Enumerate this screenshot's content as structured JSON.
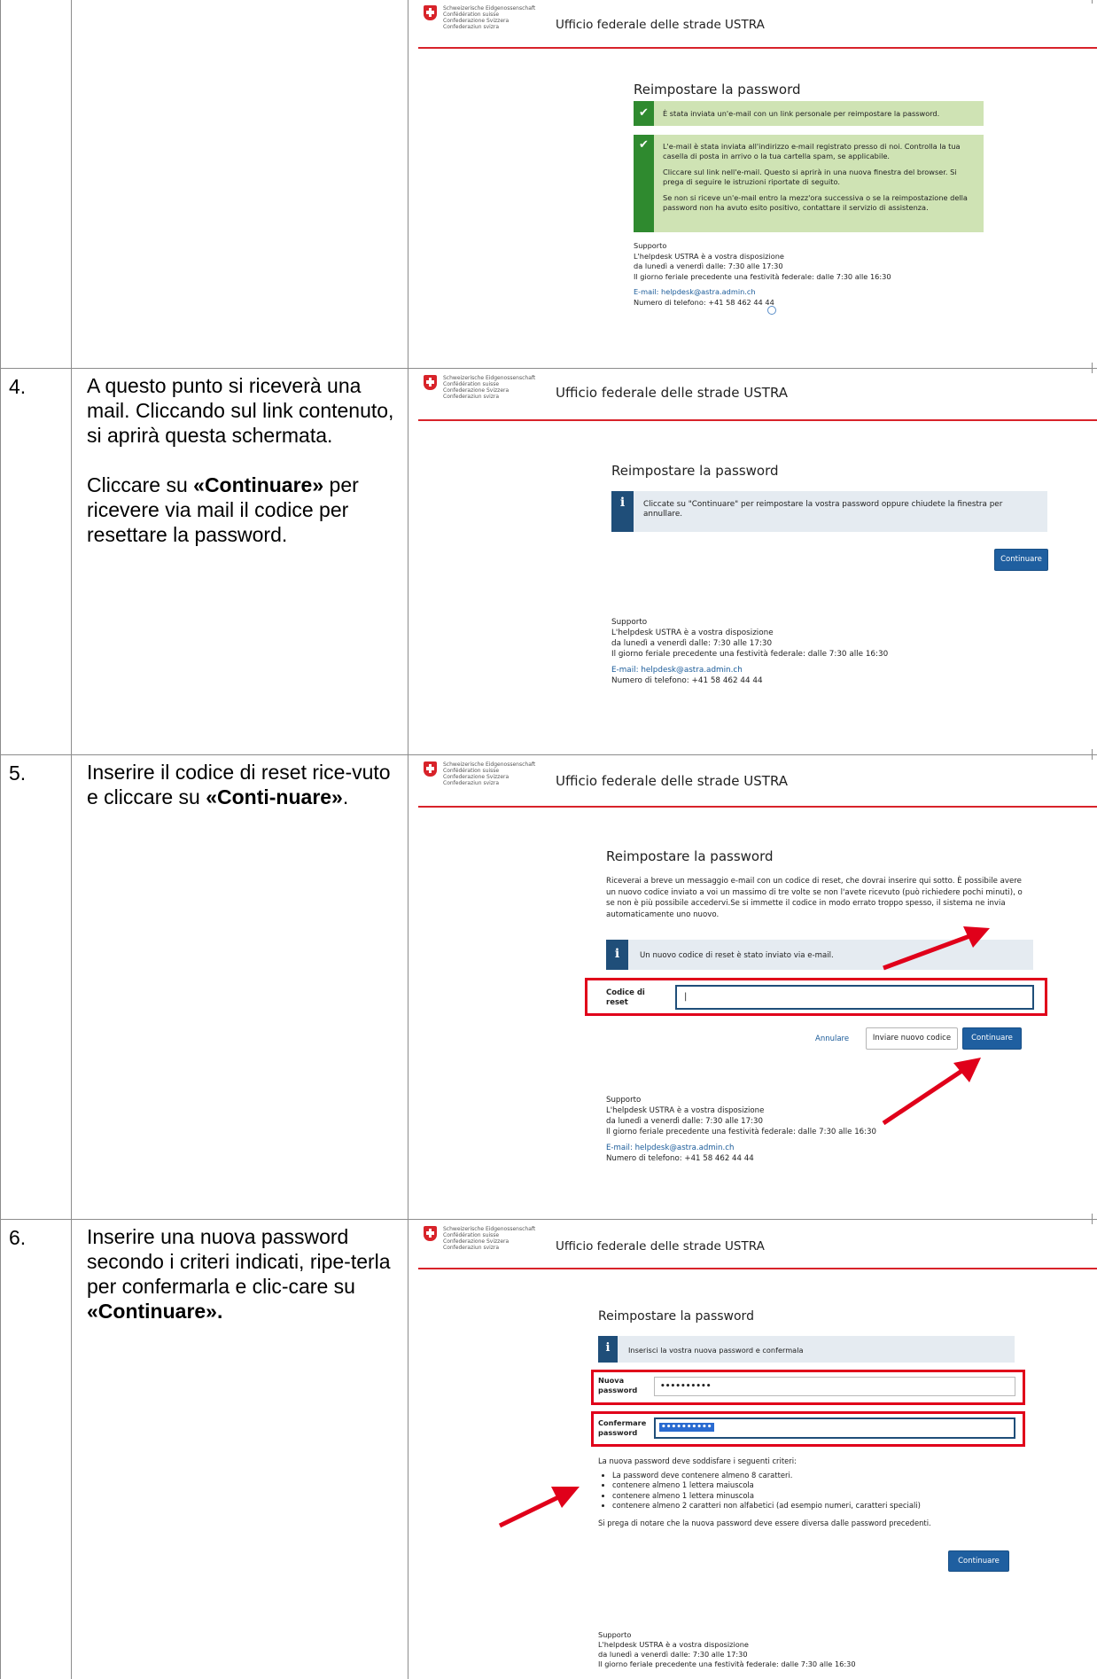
{
  "agency_title": "Ufficio federale delle strade USTRA",
  "logo_text": "Schweizerische Eidgenossenschaft\nConfédération suisse\nConfederazione Svizzera\nConfederaziun svizra",
  "page_title": "Reimpostare la password",
  "support": {
    "heading": "Supporto",
    "line1": "L'helpdesk USTRA è a vostra disposizione",
    "line2": "da lunedì a venerdì dalle: 7:30 alle 17:30",
    "line3": "Il giorno feriale precedente una festività federale: dalle 7:30 alle 16:30",
    "email": "E-mail: helpdesk@astra.admin.ch",
    "phone": "Numero di telefono: +41 58 462 44 44"
  },
  "step3": {
    "alert1": "È stata inviata un'e-mail con un link personale per reimpostare la password.",
    "alert2_p1": "L'e-mail è stata inviata all'indirizzo e-mail registrato presso di noi. Controlla la tua casella di posta in arrivo o la tua cartella spam, se applicabile.",
    "alert2_p2": "Cliccare sul link nell'e-mail. Questo si aprirà in una nuova finestra del browser. Si prega di seguire le istruzioni riportate di seguito.",
    "alert2_p3": "Se non si riceve un'e-mail entro la mezz'ora successiva o se la reimpostazione della password non ha avuto esito positivo, contattare il servizio di assistenza."
  },
  "step4": {
    "number": "4.",
    "text1": "A questo punto si riceverà una mail. Cliccando sul link contenuto, si aprirà questa schermata.",
    "text2_pre": "Cliccare su ",
    "text2_bold": "«Continuare»",
    "text2_post": " per ricevere via mail il codice per resettare la password.",
    "info": "Cliccate su \"Continuare\" per reimpostare la vostra password oppure chiudete la finestra per annullare.",
    "continue_btn": "Continuare"
  },
  "step5": {
    "number": "5.",
    "text_pre": "Inserire il codice di reset rice-vuto e cliccare su ",
    "text_bold": "«Conti-nuare»",
    "text_post": ".",
    "desc": "Riceverai a breve un messaggio e-mail con un codice di reset, che dovrai inserire qui sotto. È possibile avere un nuovo codice inviato a voi un massimo di tre volte se non l'avete ricevuto (può richiedere pochi minuti), o se non è più possibile accedervi.Se si immette il codice in modo errato troppo spesso, il sistema ne invia automaticamente uno nuovo.",
    "info": "Un nuovo codice di reset è stato inviato via e-mail.",
    "field_label": "Codice di reset",
    "field_value": "|",
    "cancel_link": "Annulare",
    "resend_btn": "Inviare nuovo codice",
    "continue_btn": "Continuare"
  },
  "step6": {
    "number": "6.",
    "text_pre": "Inserire una nuova password secondo i criteri indicati, ripe-terla per confermarla e clic-care su ",
    "text_bold": "«Continuare».",
    "info": "Inserisci la vostra nuova password e confermala",
    "new_label": "Nuova password",
    "new_value": "••••••••••",
    "confirm_label": "Confermare password",
    "confirm_value": "••••••••••",
    "criteria_intro": "La nuova password deve soddisfare i seguenti criteri:",
    "criteria": [
      "La password deve contenere almeno 8 caratteri.",
      "contenere almeno 1 lettera maiuscola",
      "contenere almeno 1 lettera minuscola",
      "contenere almeno 2 caratteri non alfabetici (ad esempio numeri, caratteri speciali)"
    ],
    "note": "Si prega di notare che la nuova password deve essere diversa dalle password precedenti.",
    "continue_btn": "Continuare"
  },
  "colors": {
    "accent_red": "#d8232a",
    "primary_blue": "#1f5fa0",
    "success_green": "#2f8a2f",
    "annotation_red": "#e0001a"
  }
}
